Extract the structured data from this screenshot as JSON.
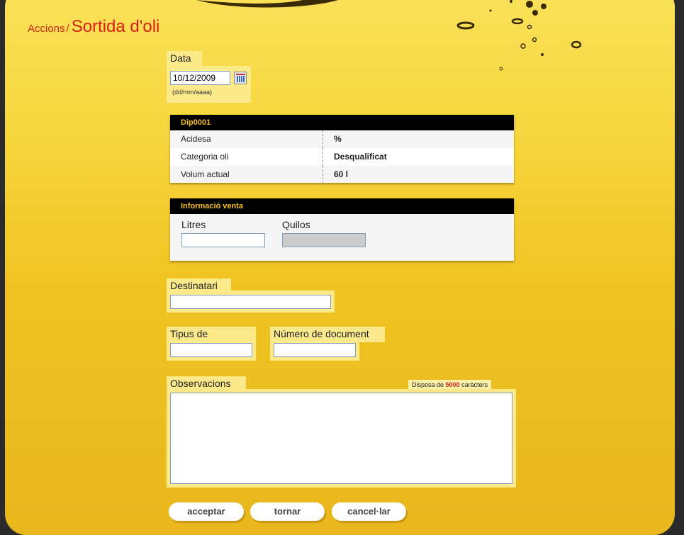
{
  "breadcrumb": {
    "parent": "Accions",
    "separator": "/",
    "current": "Sortida d'oli"
  },
  "date": {
    "label": "Data",
    "value": "10/12/2009",
    "format_hint": "(dd/mm/aaaa)"
  },
  "deposit": {
    "title": "Dip0001",
    "rows": [
      {
        "key": "Acidesa",
        "value": "%"
      },
      {
        "key": "Categoria oli",
        "value": "Desqualificat"
      },
      {
        "key": "Volum actual",
        "value": "60 l"
      }
    ]
  },
  "sale": {
    "title": "Informació venta",
    "litres_label": "Litres",
    "litres_value": "",
    "quilos_label": "Quilos",
    "quilos_value": ""
  },
  "recipient": {
    "label": "Destinatari",
    "value": ""
  },
  "document": {
    "type_label": "Tipus de document",
    "type_value": "",
    "number_label": "Número de document",
    "number_value": ""
  },
  "observations": {
    "label": "Observacions",
    "counter_prefix": "Disposa de",
    "counter_value": "5000",
    "counter_suffix": "caràcters",
    "value": ""
  },
  "buttons": {
    "accept": "acceptar",
    "back": "tornar",
    "cancel": "cancel·lar"
  },
  "colors": {
    "panel_top": "#fbe25a",
    "panel_bottom": "#e8b71d",
    "accent_red": "#d81f18",
    "label_bg": "#fce98a"
  },
  "icons": [
    "calendar-icon"
  ]
}
